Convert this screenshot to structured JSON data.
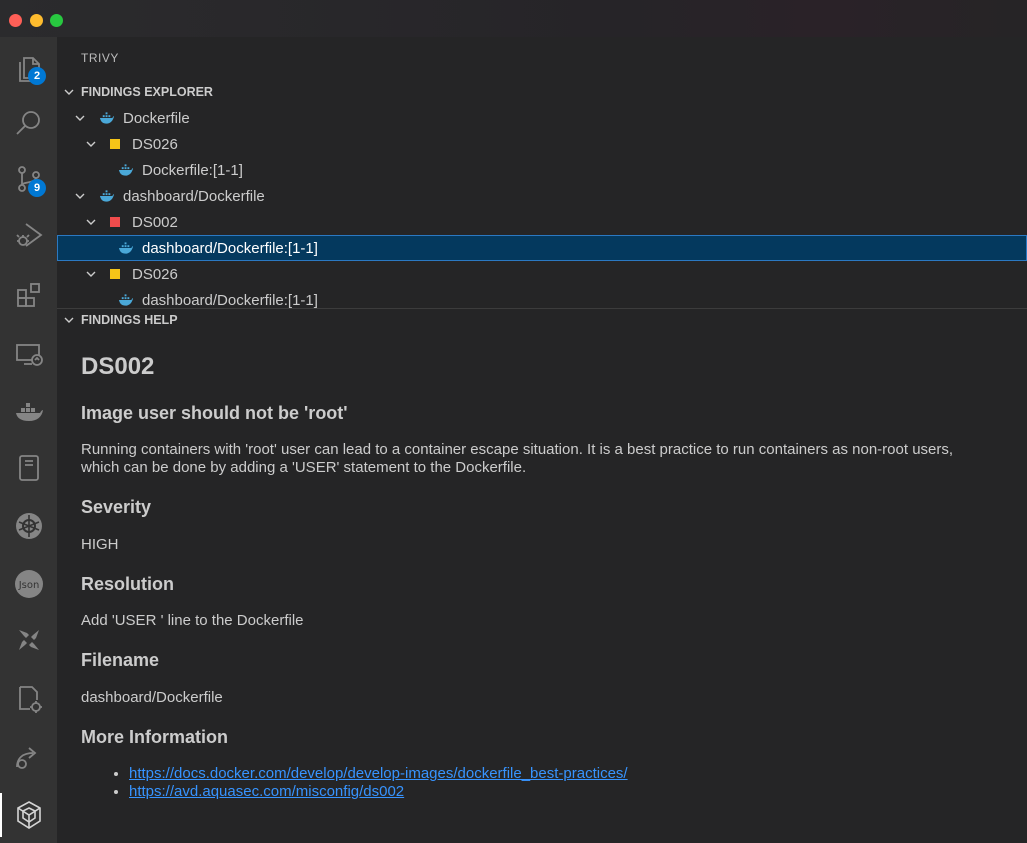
{
  "sidebar_title": "TRIVY",
  "explorer": {
    "header": "FINDINGS EXPLORER",
    "items": [
      {
        "label": "Dockerfile"
      },
      {
        "label": "DS026"
      },
      {
        "label": "Dockerfile:[1-1]"
      },
      {
        "label": "dashboard/Dockerfile"
      },
      {
        "label": "DS002"
      },
      {
        "label": "dashboard/Dockerfile:[1-1]"
      },
      {
        "label": "DS026"
      },
      {
        "label": "dashboard/Dockerfile:[1-1]"
      }
    ]
  },
  "help": {
    "header": "FINDINGS HELP",
    "id": "DS002",
    "title": "Image user should not be 'root'",
    "description_line1": "Running containers with 'root' user can lead to a container escape situation. It is a best practice to run containers as non-root users,",
    "description_line2": "which can be done by adding a 'USER' statement to the Dockerfile.",
    "severity_heading": "Severity",
    "severity": "HIGH",
    "resolution_heading": "Resolution",
    "resolution": "Add 'USER ' line to the Dockerfile",
    "filename_heading": "Filename",
    "filename": "dashboard/Dockerfile",
    "more_heading": "More Information",
    "links": [
      "https://docs.docker.com/develop/develop-images/dockerfile_best-practices/",
      "https://avd.aquasec.com/misconfig/ds002"
    ]
  },
  "badges": {
    "explorer": "2",
    "scm": "9"
  },
  "colors": {
    "severity_medium": "#f5c518",
    "severity_high": "#f14c4c",
    "selection": "#04395e",
    "link": "#3794ff"
  }
}
